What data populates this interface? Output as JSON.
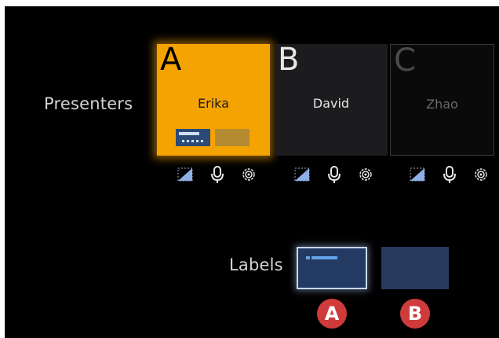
{
  "presenters": {
    "label": "Presenters",
    "cards": [
      {
        "letter": "A",
        "name": "Erika",
        "state": "selected"
      },
      {
        "letter": "B",
        "name": "David",
        "state": "normal"
      },
      {
        "letter": "C",
        "name": "Zhao",
        "state": "dimmed"
      }
    ],
    "icons": [
      "crop-icon",
      "microphone-icon",
      "gear-icon"
    ]
  },
  "labels": {
    "label": "Labels",
    "options": [
      {
        "name": "label-style-a",
        "selected": true
      },
      {
        "name": "label-style-b",
        "selected": false
      }
    ]
  },
  "callouts": [
    "A",
    "B"
  ],
  "colors": {
    "selected_card": "#f5a300",
    "card_dark": "#1c1c1e",
    "label_blue": "#233a62",
    "callout_red": "#cf3b3b"
  }
}
